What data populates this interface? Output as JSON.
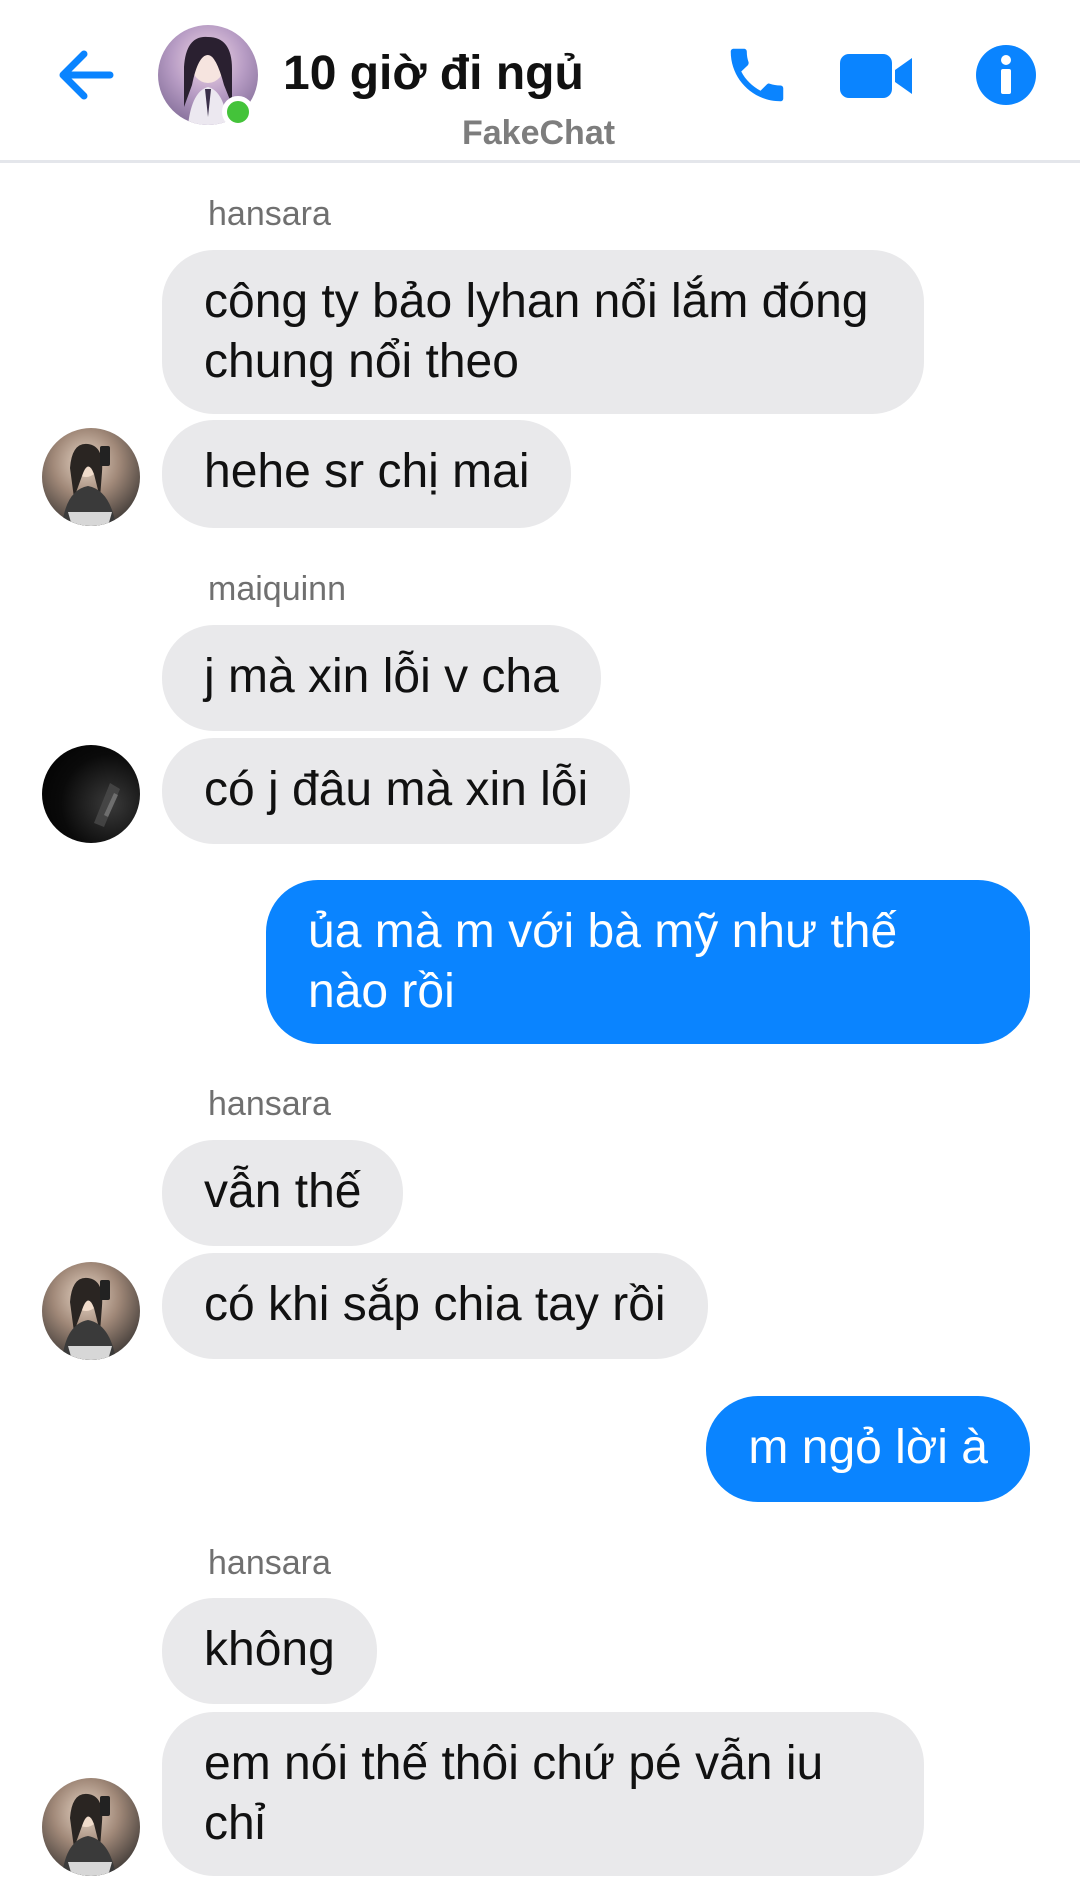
{
  "header": {
    "title": "10 giờ đi ngủ",
    "watermark": "FakeChat",
    "icons": {
      "back": "arrow-left-icon",
      "call": "phone-icon",
      "video": "video-camera-icon",
      "info": "info-icon"
    },
    "accent_color": "#0a84ff",
    "online_color": "#44c33a"
  },
  "messages": [
    {
      "sender": "hansara",
      "bubbles": [
        "công ty bảo lyhan nổi lắm đóng chung nổi theo",
        "hehe sr chị mai"
      ]
    },
    {
      "sender": "maiquinn",
      "bubbles": [
        "j mà xin lỗi v cha",
        "có j đâu mà xin lỗi"
      ]
    },
    {
      "sender": "me",
      "bubbles": [
        "ủa mà m với bà mỹ như thế nào rồi"
      ]
    },
    {
      "sender": "hansara",
      "bubbles": [
        "vẫn thế",
        "có khi sắp chia tay rồi"
      ]
    },
    {
      "sender": "me",
      "bubbles": [
        "m ngỏ lời à"
      ]
    },
    {
      "sender": "hansara",
      "bubbles": [
        "không",
        "em nói thế thôi chứ pé vẫn iu chỉ"
      ]
    }
  ]
}
